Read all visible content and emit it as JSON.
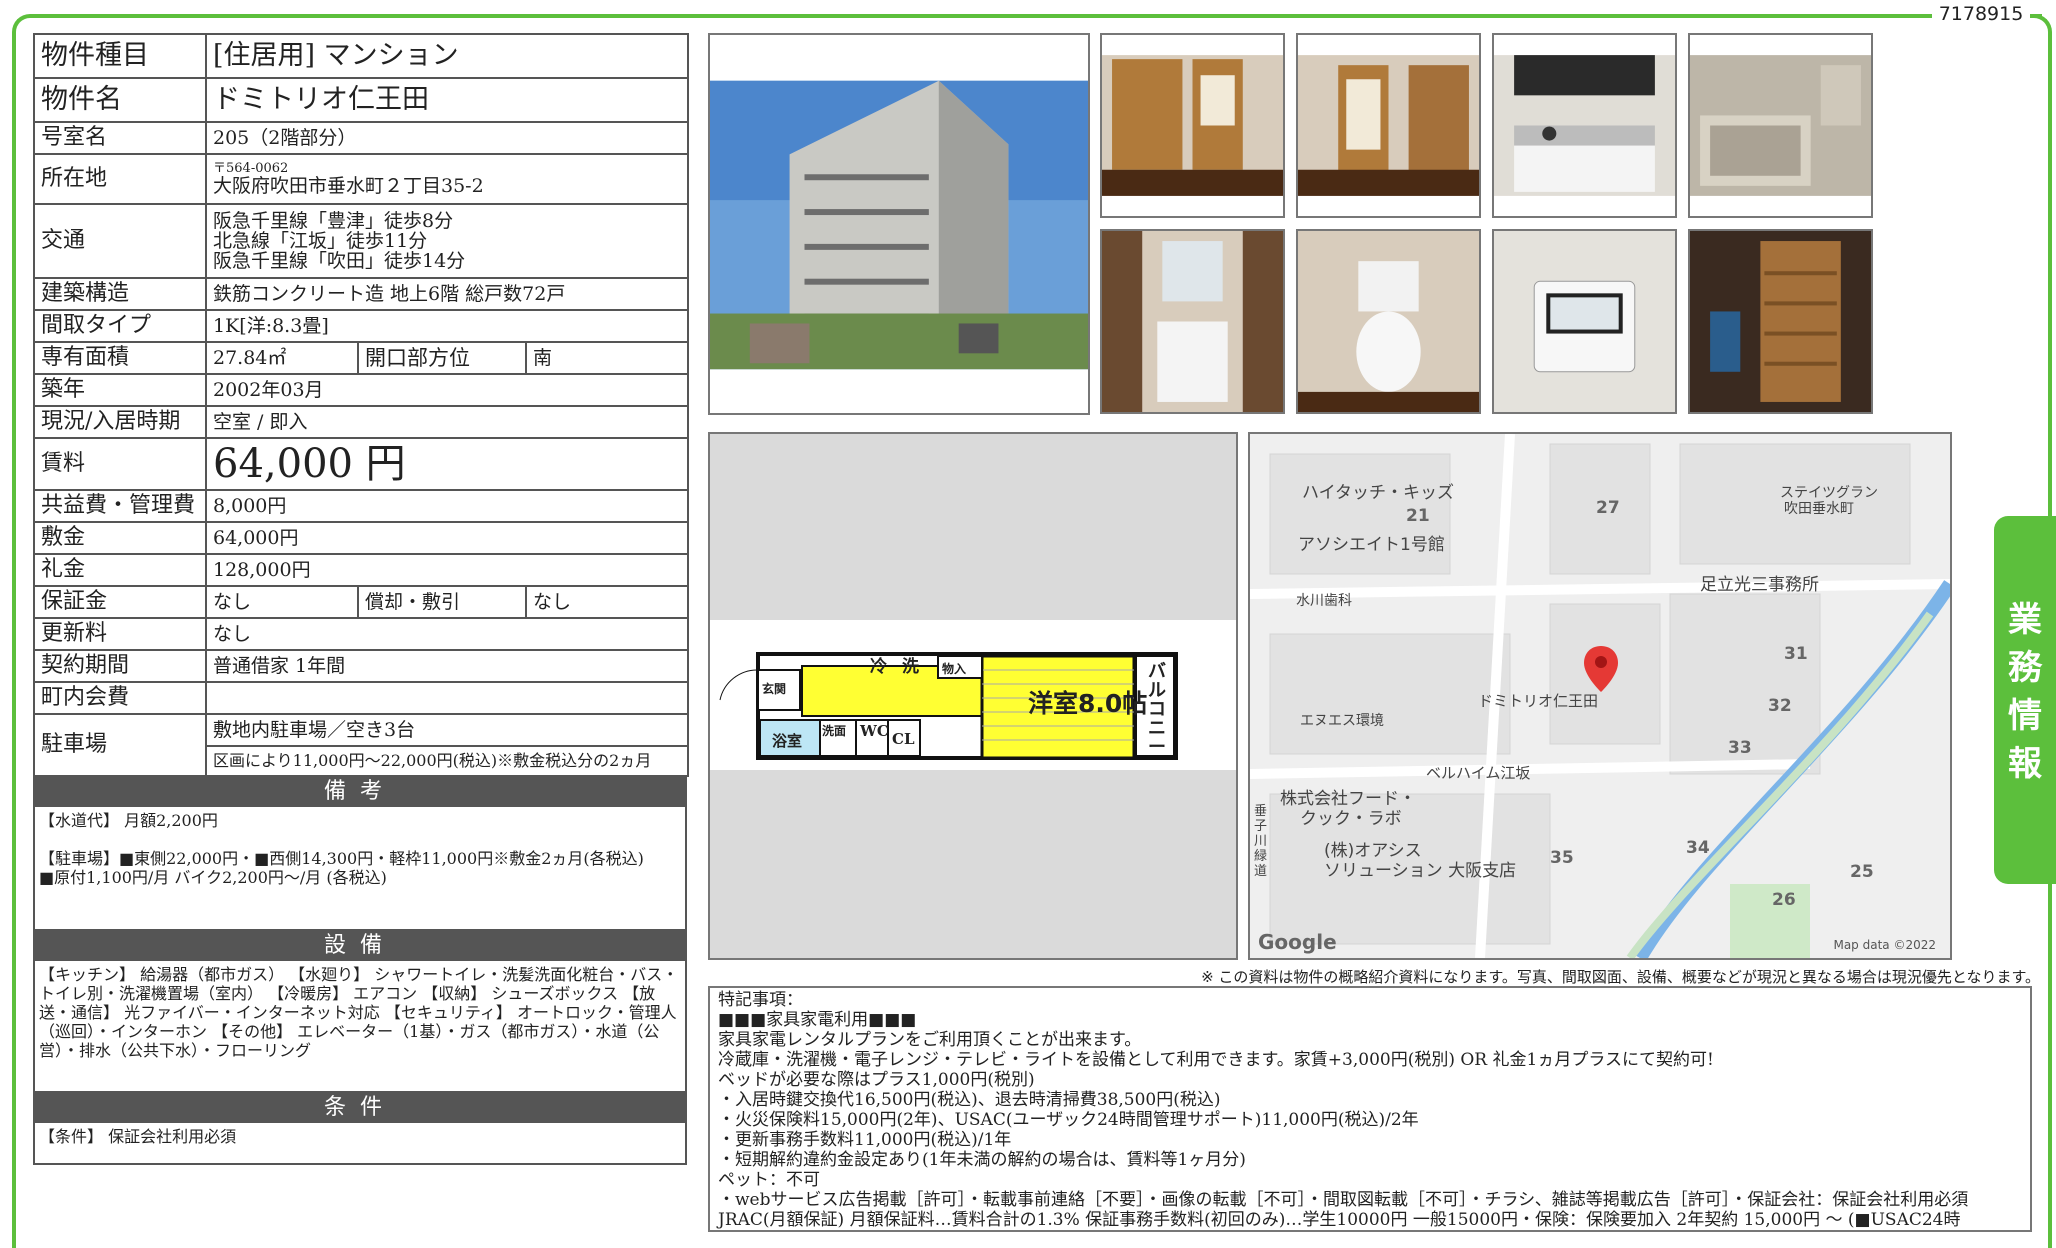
{
  "property_id": "7178915",
  "table": {
    "type_label": "物件種目",
    "type_value": "[住居用]  マンション",
    "name_label": "物件名",
    "name_value": "ドミトリオ仁王田",
    "room_label": "号室名",
    "room_value": "205（2階部分）",
    "address_label": "所在地",
    "postal": "〒564-0062",
    "address": "大阪府吹田市垂水町２丁目35-2",
    "transit_label": "交通",
    "transit": [
      "阪急千里線「豊津」徒歩8分",
      "北急線「江坂」徒歩11分",
      "阪急千里線「吹田」徒歩14分"
    ],
    "structure_label": "建築構造",
    "structure_value": "鉄筋コンクリート造  地上6階  総戸数72戸",
    "layout_label": "間取タイプ",
    "layout_value": "1K[洋:8.3畳]",
    "area_label": "専有面積",
    "area_value": "27.84㎡",
    "direction_label": "開口部方位",
    "direction_value": "南",
    "built_label": "築年",
    "built_value": "2002年03月",
    "status_label": "現況/入居時期",
    "status_value": "空室  /  即入",
    "rent_label": "賃料",
    "rent_value": "64,000 円",
    "common_label": "共益費・管理費",
    "common_value": "8,000円",
    "deposit_label": "敷金",
    "deposit_value": "64,000円",
    "key_label": "礼金",
    "key_value": "128,000円",
    "guarantee_label": "保証金",
    "guarantee_value": "なし",
    "amort_label": "償却・敷引",
    "amort_value": "なし",
    "renewal_label": "更新料",
    "renewal_value": "なし",
    "contract_label": "契約期間",
    "contract_value": "普通借家  1年間",
    "town_label": "町内会費",
    "town_value": "",
    "parking_label": "駐車場",
    "parking_value": "敷地内駐車場／空き3台",
    "parking_note": "区画により11,000円～22,000円(税込)※敷金税込分の2ヵ月"
  },
  "remarks": {
    "title": "備考",
    "lines": [
      "【水道代】    月額2,200円",
      "",
      "【駐車場】■東側22,000円・■西側14,300円・軽枠11,000円※敷金2ヵ月(各税込)",
      "■原付1,100円/月    バイク2,200円～/月    (各税込)"
    ]
  },
  "facilities": {
    "title": "設備",
    "lines": [
      "【キッチン】  給湯器（都市ガス）  【水廻り】  シャワートイレ・洗髪洗面化粧台・バス・トイレ別・洗濯機置場（室内）  【冷暖房】  エアコン  【収納】  シューズボックス  【放送・通信】  光ファイバー・インターネット対応  【セキュリティ】  オートロック・管理人（巡回）・インターホン  【その他】  エレベーター（1基）・ガス（都市ガス）・水道（公営）・排水（公共下水）・フローリング"
    ]
  },
  "conditions": {
    "title": "条件",
    "lines": [
      "【条件】  保証会社利用必須"
    ]
  },
  "floorplan": {
    "room": "洋室8.0帖",
    "balcony": "バルコニー",
    "entrance": "玄関",
    "bath": "浴室",
    "wash": "洗面",
    "wc": "WC",
    "cl": "CL",
    "fridge": "冷",
    "washer": "洗",
    "storage": "物入"
  },
  "map": {
    "labels": [
      "ハイタッチ・キッズ",
      "アソシエイト1号館",
      "水川歯科",
      "足立光三事務所",
      "ドミトリオ仁王田",
      "エヌエス環境",
      "ベルハイム江坂",
      "株式会社フード・",
      "クック・ラボ",
      "(株)オアシス",
      "ソリューション 大阪支店",
      "ステイツグラン",
      "吹田垂水町",
      "垂子川緑道"
    ],
    "numbers": [
      "21",
      "27",
      "31",
      "32",
      "33",
      "34",
      "35",
      "25",
      "26"
    ],
    "google": "Google",
    "mapdata": "Map data ©2022",
    "accent": "#e53935"
  },
  "disclaimer": "※  この資料は物件の概略紹介資料になります。写真、間取図面、設備、概要などが現況と異なる場合は現況優先となります。",
  "special": {
    "lines": [
      "特記事項：",
      "■■■家具家電利用■■■",
      "家具家電レンタルプランをご利用頂くことが出来ます。",
      "冷蔵庫・洗濯機・電子レンジ・テレビ・ライトを設備として利用できます。家賃+3,000円(税別)  OR  礼金1ヵ月プラスにて契約可!",
      "ベッドが必要な際はプラス1,000円(税別)",
      "・入居時鍵交換代16,500円(税込)、退去時清掃費38,500円(税込)",
      "・火災保険料15,000円(2年)、USAC(ユーザック24時間管理サポート)11,000円(税込)/2年",
      "・更新事務手数料11,000円(税込)/1年",
      "・短期解約違約金設定あり(1年未満の解約の場合は、賃料等1ヶ月分)",
      "ペット：不可",
      "・webサービス広告掲載［許可］・転載事前連絡［不要］・画像の転載［不可］・間取図転載［不可］・チラシ、雑誌等掲載広告［許可］・保証会社：保証会社利用必須",
      "JRAC(月額保証)  月額保証料…賃料合計の1.3%  保証事務手数料(初回のみ)…学生10000円   一般15000円・保険：保険要加入 2年契約 15,000円 ～  (■USAC24時"
    ]
  },
  "tab": {
    "chars": [
      "業",
      "務",
      "情",
      "報"
    ]
  },
  "colors": {
    "accent": "#5cbf3c",
    "header": "#555555",
    "floor_yellow": "#ffff33"
  }
}
